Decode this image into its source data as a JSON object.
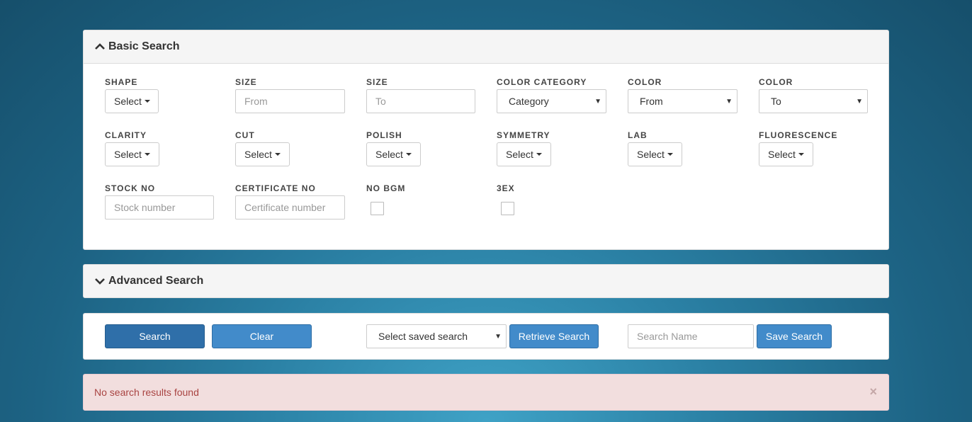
{
  "basic": {
    "title": "Basic Search",
    "shape": {
      "label": "SHAPE",
      "value": "Select"
    },
    "size_from": {
      "label": "SIZE",
      "placeholder": "From"
    },
    "size_to": {
      "label": "SIZE",
      "placeholder": "To"
    },
    "color_category": {
      "label": "COLOR CATEGORY",
      "value": "Category"
    },
    "color_from": {
      "label": "COLOR",
      "value": "From"
    },
    "color_to": {
      "label": "COLOR",
      "value": "To"
    },
    "clarity": {
      "label": "CLARITY",
      "value": "Select"
    },
    "cut": {
      "label": "CUT",
      "value": "Select"
    },
    "polish": {
      "label": "POLISH",
      "value": "Select"
    },
    "symmetry": {
      "label": "SYMMETRY",
      "value": "Select"
    },
    "lab": {
      "label": "LAB",
      "value": "Select"
    },
    "fluorescence": {
      "label": "FLUORESCENCE",
      "value": "Select"
    },
    "stock_no": {
      "label": "STOCK NO",
      "placeholder": "Stock number"
    },
    "certificate_no": {
      "label": "CERTIFICATE NO",
      "placeholder": "Certificate number"
    },
    "no_bgm": {
      "label": "NO BGM",
      "checked": false
    },
    "three_ex": {
      "label": "3EX",
      "checked": false
    }
  },
  "advanced": {
    "title": "Advanced Search"
  },
  "actions": {
    "search_label": "Search",
    "clear_label": "Clear",
    "saved_search": "Select saved search",
    "retrieve_label": "Retrieve Search",
    "search_name_placeholder": "Search Name",
    "save_label": "Save Search"
  },
  "alert": {
    "message": "No search results found",
    "close": "×"
  },
  "colors": {
    "primary": "#428bca",
    "primary_dark": "#2f6fa9",
    "alert_bg": "#f2dede",
    "alert_text": "#a94442"
  }
}
